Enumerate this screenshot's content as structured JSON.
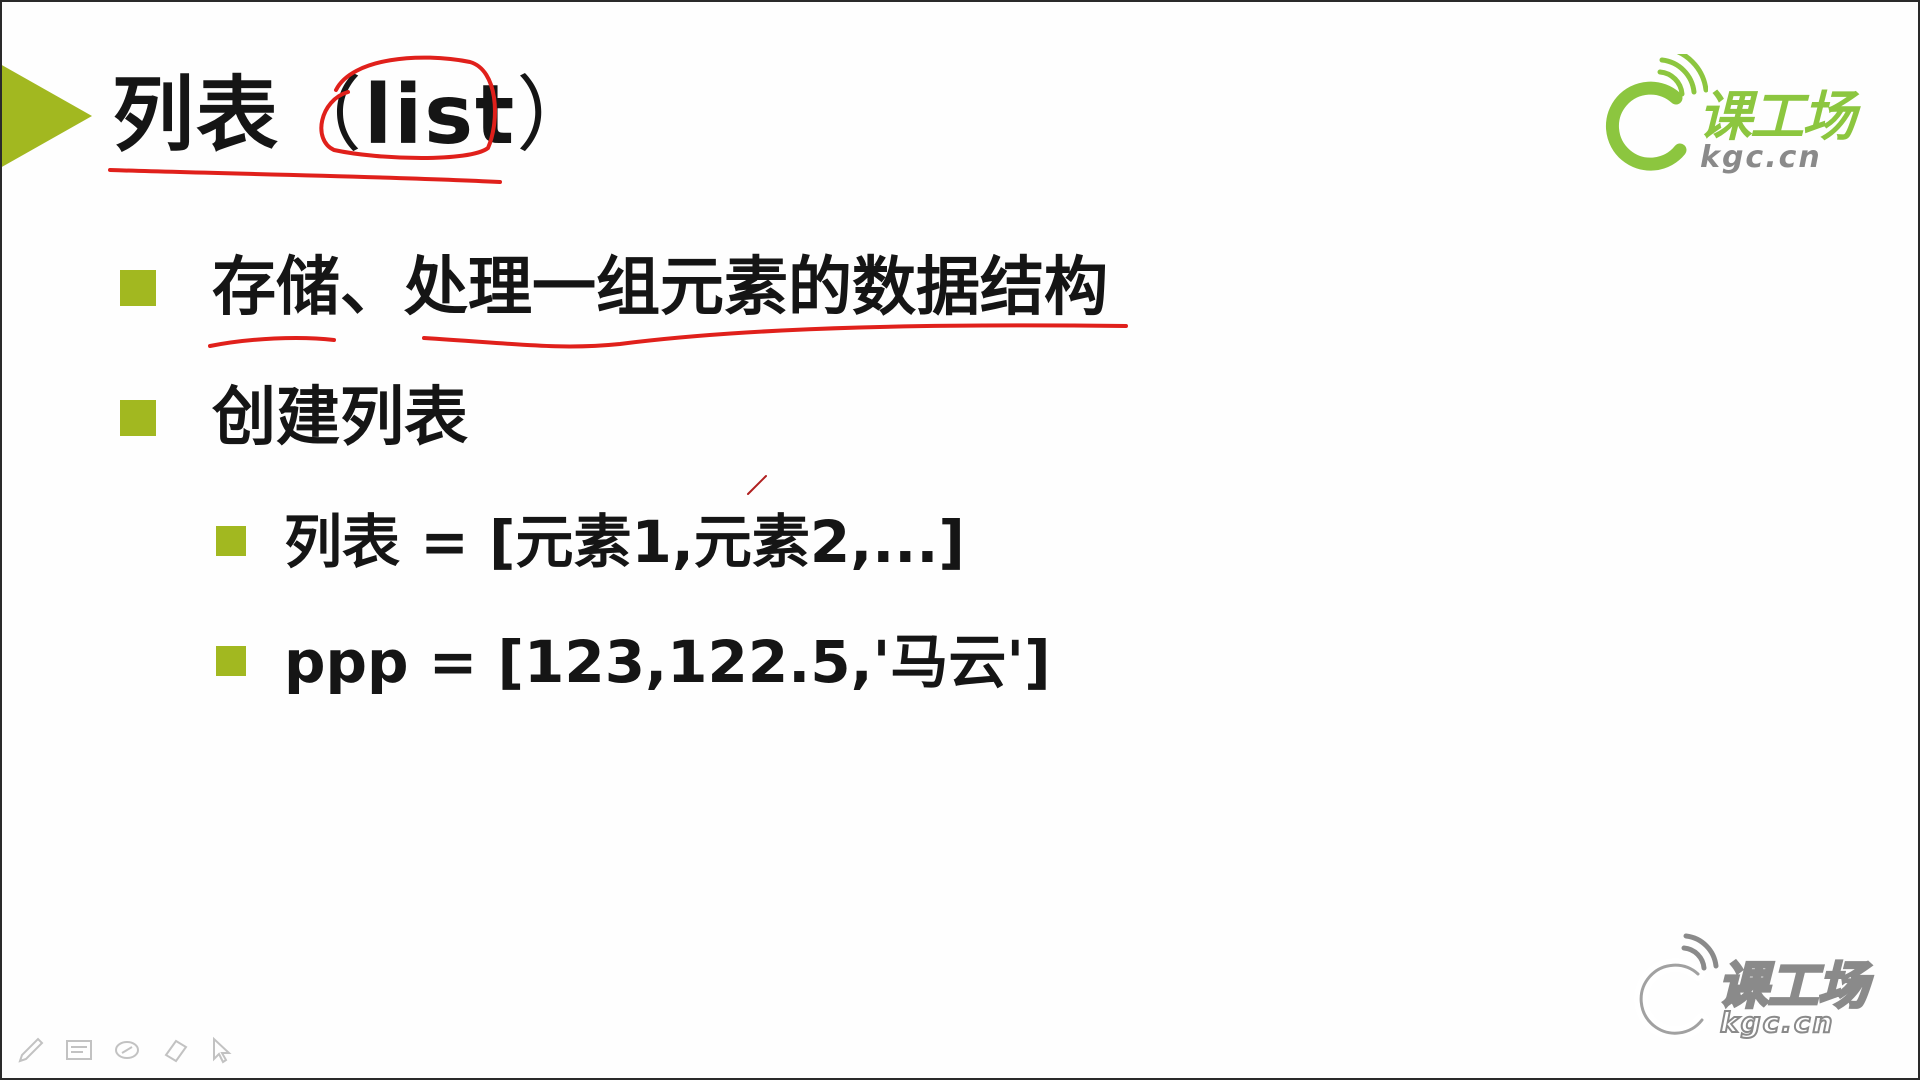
{
  "slide": {
    "title_main": "列表",
    "title_open": "（",
    "title_keyword": "list",
    "title_close": "）",
    "bullets": [
      {
        "text": "存储、处理一组元素的数据结构"
      },
      {
        "text": "创建列表"
      }
    ],
    "sub_bullets": [
      {
        "text": "列表 = [元素1,元素2,...]"
      },
      {
        "text": "ppp = [123,122.5,'马云']"
      }
    ]
  },
  "logo": {
    "brand": "课工场",
    "domain": "kgc.cn"
  },
  "watermark": {
    "brand": "课工场",
    "domain": "kgc.cn"
  },
  "toolbar": {
    "tools": [
      "pen-icon",
      "slides-icon",
      "highlighter-icon",
      "eraser-icon",
      "pointer-icon"
    ]
  },
  "colors": {
    "accent_green": "#a2b820",
    "logo_green": "#8cc63f",
    "annotation_red": "#e0201b",
    "text": "#151515"
  }
}
